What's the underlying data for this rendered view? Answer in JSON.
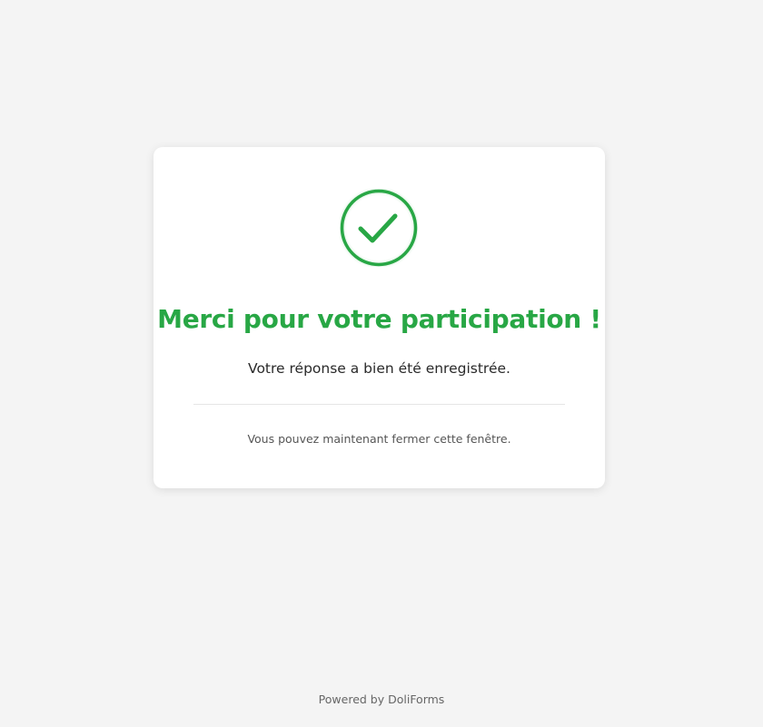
{
  "confirmation": {
    "title": "Merci pour votre participation !",
    "message": "Votre réponse a bien été enregistrée.",
    "hint": "Vous pouvez maintenant fermer cette fenêtre.",
    "icon": "check-circle-icon"
  },
  "footer": {
    "powered_by": "Powered by DoliForms"
  },
  "colors": {
    "success": "#28a745",
    "background": "#f4f4f4",
    "card": "#ffffff"
  }
}
